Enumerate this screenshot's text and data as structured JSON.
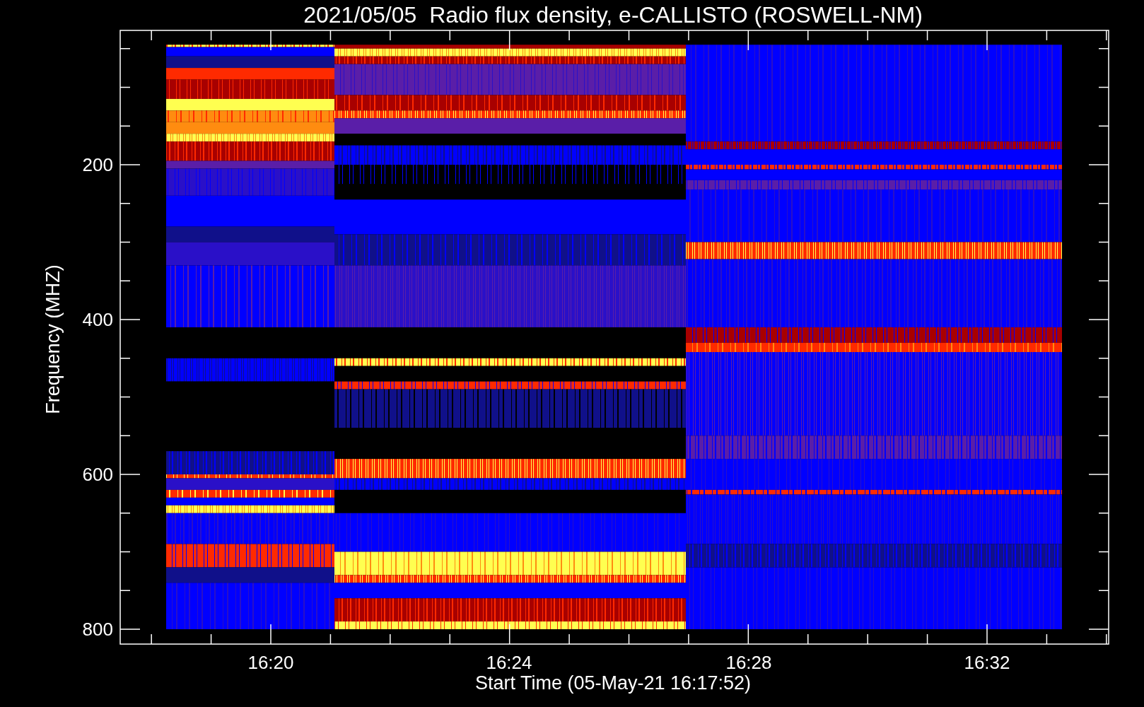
{
  "title": "2021/05/05  Radio flux density, e-CALLISTO (ROSWELL-NM)",
  "y_axis": {
    "label": "Frequency (MHZ)",
    "ticks": [
      "200",
      "400",
      "600",
      "800"
    ]
  },
  "x_axis": {
    "label": "Start Time (05-May-21 16:17:52)",
    "ticks": [
      "16:20",
      "16:24",
      "16:28",
      "16:32"
    ]
  }
}
